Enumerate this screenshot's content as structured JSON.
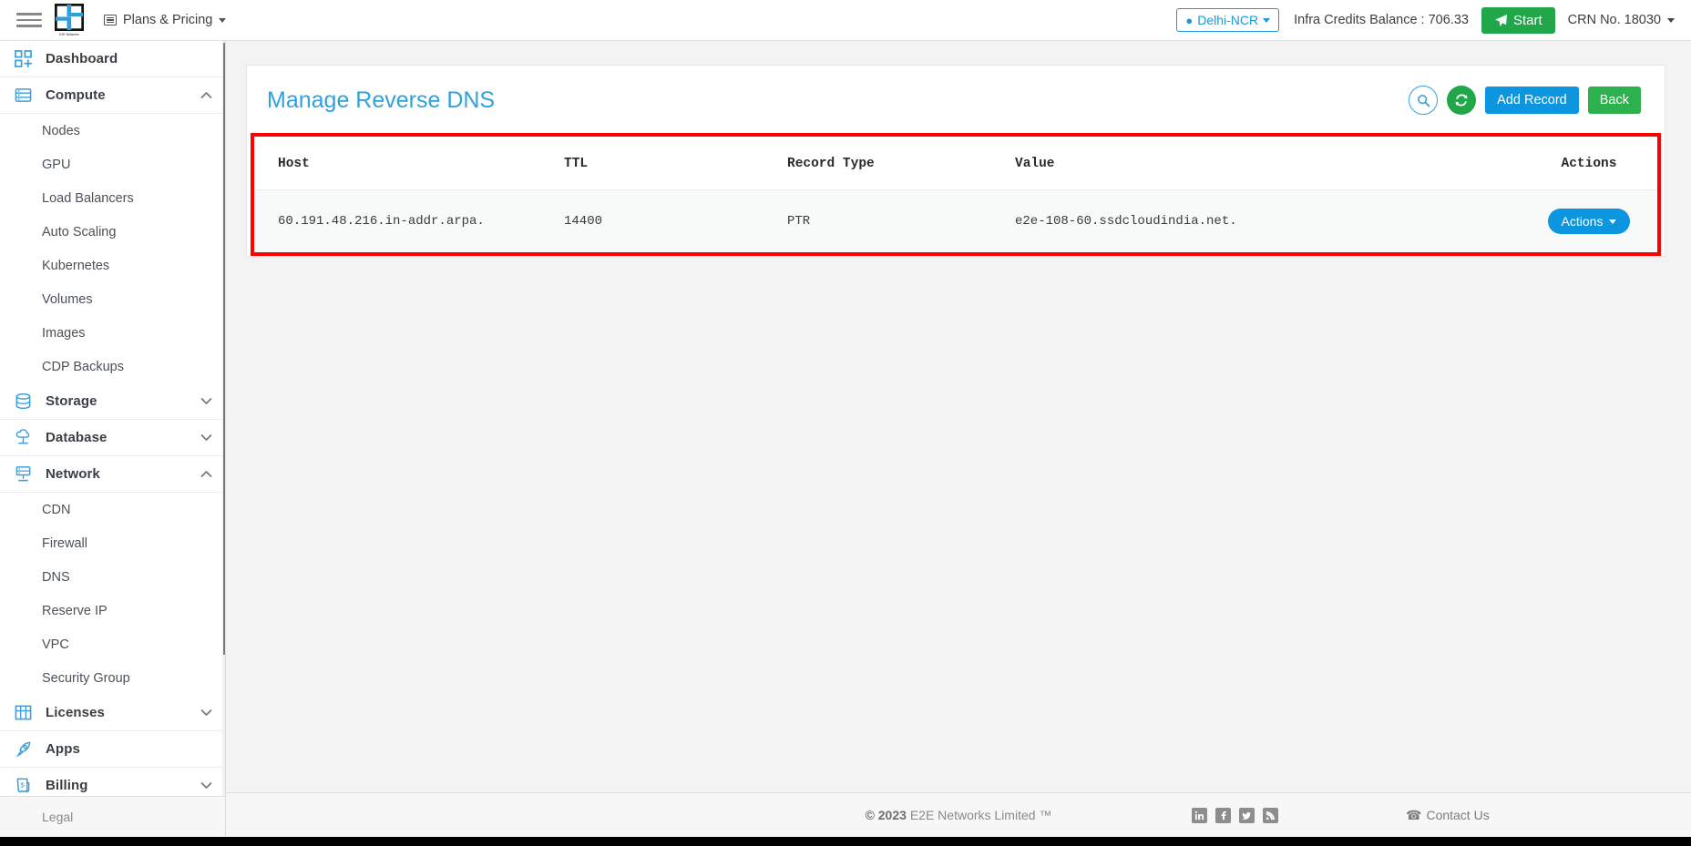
{
  "topbar": {
    "menu_icon": "hamburger-icon",
    "brand": "E2E Networks",
    "plans_label": "Plans & Pricing",
    "plans_icon": "list-icon",
    "region": "Delhi-NCR",
    "region_icon": "map-pin-icon",
    "credits": "Infra Credits Balance : 706.33",
    "start_label": "Start",
    "start_icon": "paper-plane-icon",
    "crn": "CRN No. 18030",
    "accent_blue": "#1a9ada",
    "start_green": "#22a64a"
  },
  "sidebar": {
    "groups": [
      {
        "label": "Dashboard",
        "icon": "dashboard-grid-icon",
        "chevron": "none",
        "items": []
      },
      {
        "label": "Compute",
        "icon": "server-icon",
        "chevron": "up",
        "items": [
          "Nodes",
          "GPU",
          "Load Balancers",
          "Auto Scaling",
          "Kubernetes",
          "Volumes",
          "Images",
          "CDP Backups"
        ]
      },
      {
        "label": "Storage",
        "icon": "database-icon",
        "chevron": "down",
        "items": []
      },
      {
        "label": "Database",
        "icon": "cloud-database-icon",
        "chevron": "down",
        "items": []
      },
      {
        "label": "Network",
        "icon": "network-icon",
        "chevron": "up",
        "items": [
          "CDN",
          "Firewall",
          "DNS",
          "Reserve IP",
          "VPC",
          "Security Group"
        ]
      },
      {
        "label": "Licenses",
        "icon": "license-grid-icon",
        "chevron": "down",
        "items": []
      },
      {
        "label": "Apps",
        "icon": "rocket-icon",
        "chevron": "none",
        "items": []
      },
      {
        "label": "Billing",
        "icon": "invoice-icon",
        "chevron": "down",
        "items": []
      }
    ],
    "legal_label": "Legal"
  },
  "main": {
    "page_title": "Manage Reverse DNS",
    "title_color": "#2fa1df",
    "buttons": {
      "search_icon": "search-icon",
      "refresh_icon": "refresh-icon",
      "add_record": "Add Record",
      "back": "Back"
    },
    "table": {
      "highlight_color": "#fe0000",
      "columns": [
        "Host",
        "TTL",
        "Record Type",
        "Value",
        "Actions"
      ],
      "rows": [
        {
          "host": "60.191.48.216.in-addr.arpa.",
          "ttl": "14400",
          "record_type": "PTR",
          "value": "e2e-108-60.ssdcloudindia.net.",
          "action_label": "Actions"
        }
      ]
    }
  },
  "footer": {
    "copyright_prefix": "© 2023",
    "copyright_rest": "E2E Networks Limited ™",
    "socials": [
      "linkedin-icon",
      "facebook-icon",
      "twitter-icon",
      "rss-icon"
    ],
    "contact_label": "Contact Us",
    "contact_icon": "phone-icon"
  }
}
